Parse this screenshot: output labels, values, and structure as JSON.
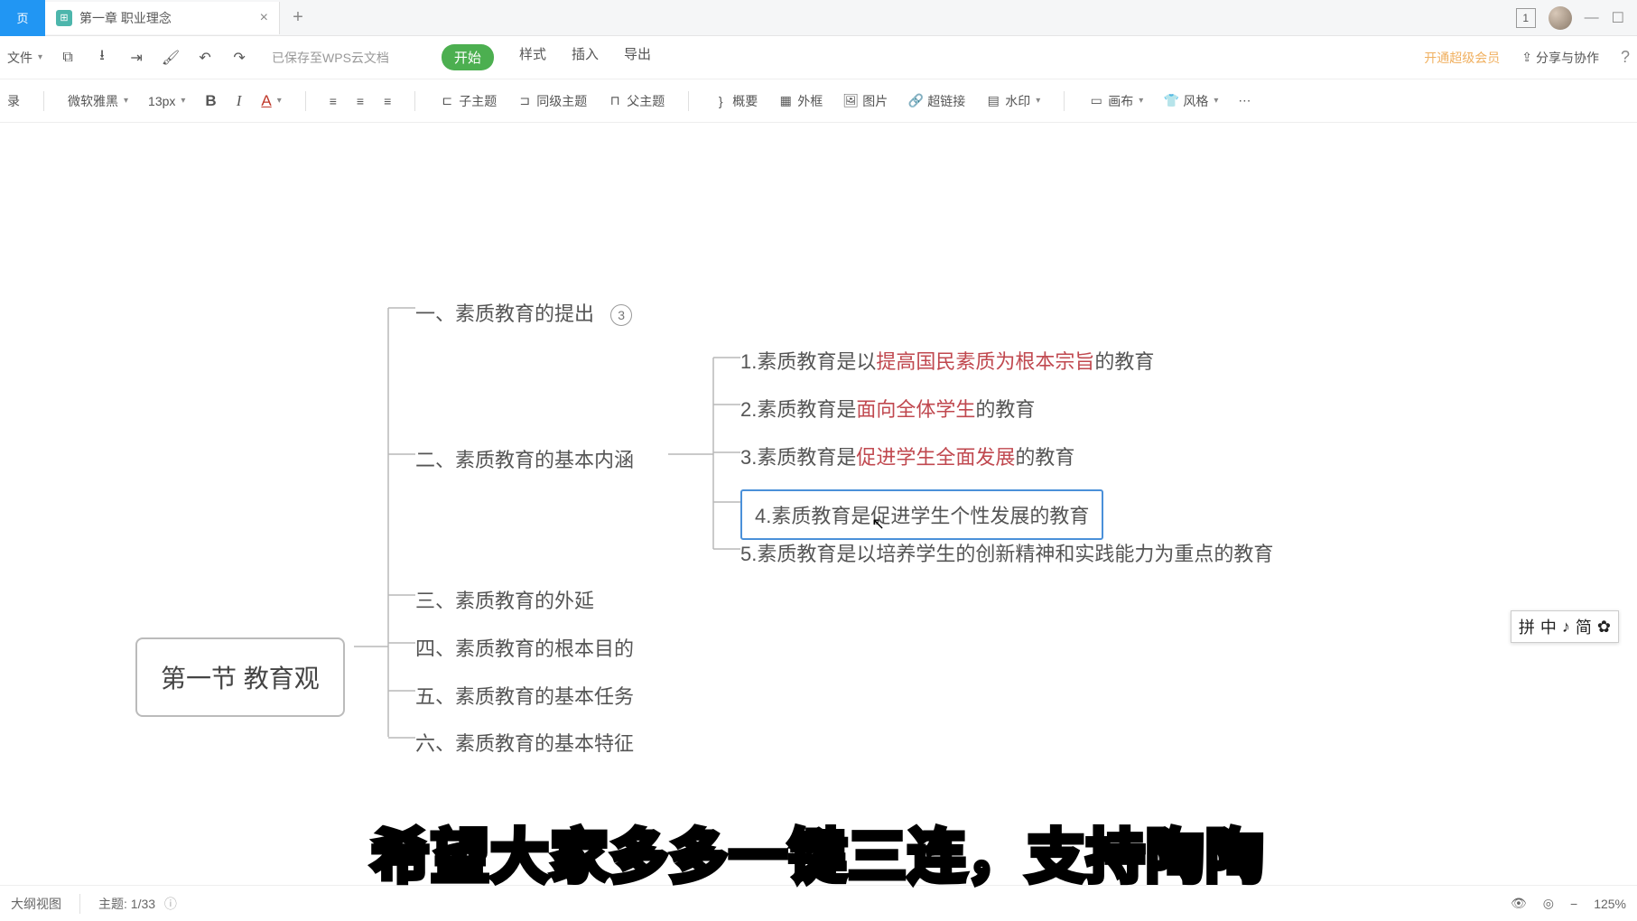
{
  "tabs": {
    "home": "页",
    "title": "第一章 职业理念",
    "badge": "1"
  },
  "quickbar": {
    "file": "文件",
    "saved": "已保存至WPS云文档",
    "menu": {
      "start": "开始",
      "style": "样式",
      "insert": "插入",
      "export": "导出"
    },
    "vip": "开通超级会员",
    "share": "分享与协作"
  },
  "toolbar": {
    "record": "录",
    "font": "微软雅黑",
    "size": "13px",
    "subtopic": "子主题",
    "peertopic": "同级主题",
    "parenttopic": "父主题",
    "summary": "概要",
    "border": "外框",
    "image": "图片",
    "link": "超链接",
    "watermark": "水印",
    "canvas": "画布",
    "style": "风格"
  },
  "mindmap": {
    "root": "第一节 教育观",
    "b1": {
      "num": "一、",
      "text": "素质教育的提出",
      "count": "3"
    },
    "b2": {
      "num": "二、",
      "text": "素质教育的基本内涵"
    },
    "b3": {
      "num": "三、",
      "text": "素质教育的外延"
    },
    "b4": {
      "num": "四、",
      "text": "素质教育的根本目的"
    },
    "b5": {
      "num": "五、",
      "text": "素质教育的基本任务"
    },
    "b6": {
      "num": "六、",
      "text": "素质教育的基本特征"
    },
    "leaf1": {
      "pre": "1.素质教育是以",
      "hl": "提高国民素质为根本宗旨",
      "post": "的教育"
    },
    "leaf2": {
      "pre": "2.素质教育是",
      "hl": "面向全体学生",
      "post": "的教育"
    },
    "leaf3": {
      "pre": "3.素质教育是",
      "hl": "促进学生全面发展",
      "post": "的教育"
    },
    "leaf4": {
      "text": "4.素质教育是促进学生个性发展的教育"
    },
    "leaf5": {
      "text": "5.素质教育是以培养学生的创新精神和实践能力为重点的教育"
    }
  },
  "ime": {
    "s1": "拼",
    "s2": "中",
    "s3": "♪",
    "s4": "简",
    "s5": "✿"
  },
  "status": {
    "outline": "大纲视图",
    "topic_label": "主题:",
    "topic_count": "1/33",
    "zoom": "125%"
  },
  "subtitle": "希望大家多多一键三连，支持陶陶"
}
